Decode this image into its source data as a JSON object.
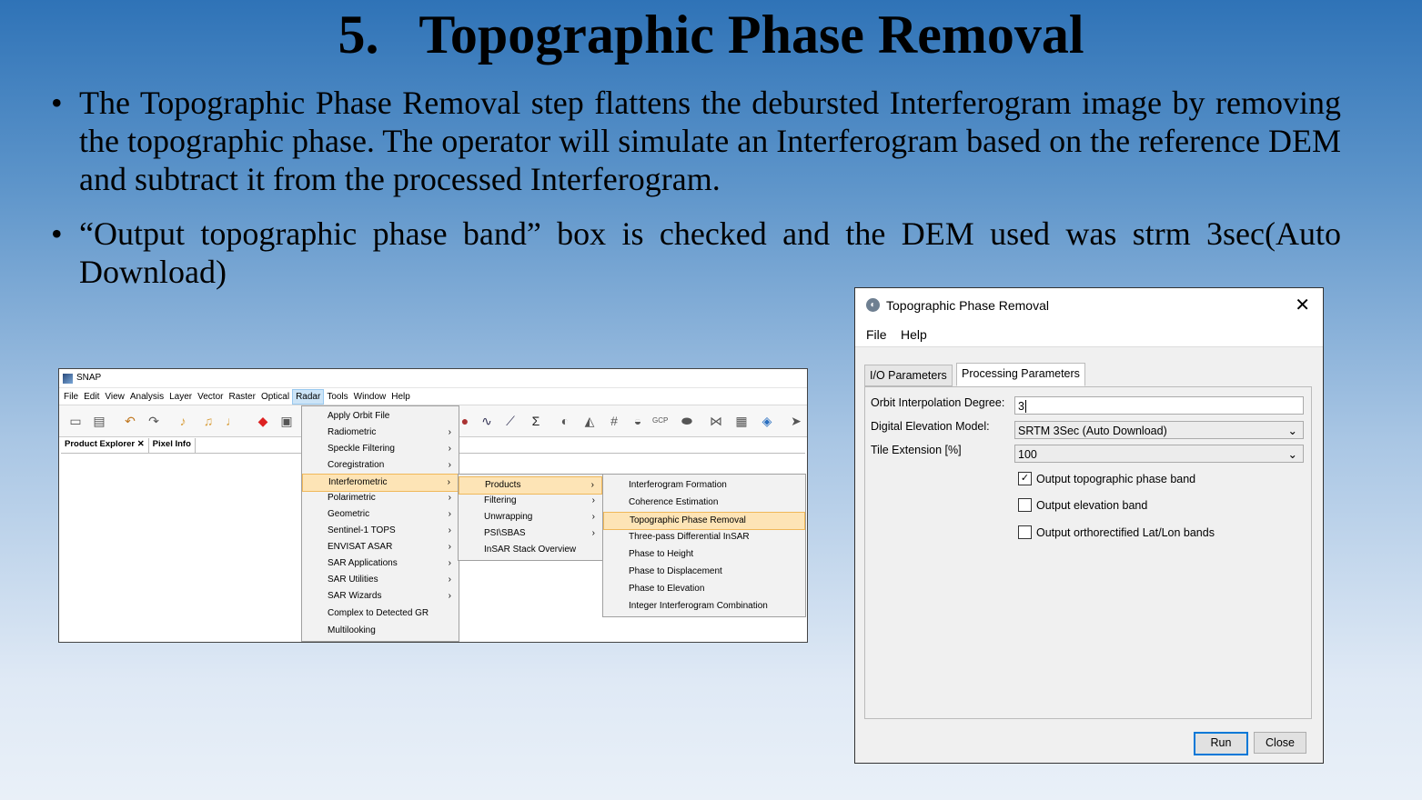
{
  "slide": {
    "title": "5.   Topographic Phase Removal",
    "bullets": [
      "The Topographic Phase Removal step flattens the debursted Interferogram image by removing the topographic phase. The operator will simulate an Interferogram based on the reference DEM and subtract it from the processed Interferogram.",
      "“Output topographic phase band” box is checked and the DEM used was strm 3sec(Auto Download)"
    ]
  },
  "snap": {
    "title": "SNAP",
    "menubar": [
      "File",
      "Edit",
      "View",
      "Analysis",
      "Layer",
      "Vector",
      "Raster",
      "Optical",
      "Radar",
      "Tools",
      "Window",
      "Help"
    ],
    "active_menu": "Radar",
    "tabs": [
      "Product Explorer ✕",
      "Pixel Info"
    ],
    "radar_menu": [
      "Apply Orbit File",
      "Radiometric",
      "Speckle Filtering",
      "Coregistration",
      "Interferometric",
      "Polarimetric",
      "Geometric",
      "Sentinel-1 TOPS",
      "ENVISAT ASAR",
      "SAR Applications",
      "SAR Utilities",
      "SAR Wizards",
      "Complex to Detected GR",
      "Multilooking"
    ],
    "interferometric_menu": [
      "Products",
      "Filtering",
      "Unwrapping",
      "PSI\\SBAS",
      "InSAR Stack Overview"
    ],
    "products_menu": [
      "Interferogram Formation",
      "Coherence Estimation",
      "Topographic Phase Removal",
      "Three-pass Differential InSAR",
      "Phase to Height",
      "Phase to Displacement",
      "Phase to Elevation",
      "Integer Interferogram Combination"
    ],
    "toolbar_gcp": "GCP"
  },
  "dialog": {
    "title": "Topographic Phase Removal",
    "menu": [
      "File",
      "Help"
    ],
    "tabs": [
      "I/O Parameters",
      "Processing Parameters"
    ],
    "orbit_label": "Orbit Interpolation Degree:",
    "orbit_value": "3",
    "dem_label": "Digital Elevation Model:",
    "dem_value": "SRTM 3Sec (Auto Download)",
    "tile_label": "Tile Extension [%]",
    "tile_value": "100",
    "check_topo": "Output topographic phase band",
    "check_elev": "Output elevation band",
    "check_latlon": "Output orthorectified Lat/Lon bands",
    "run": "Run",
    "close": "Close"
  }
}
